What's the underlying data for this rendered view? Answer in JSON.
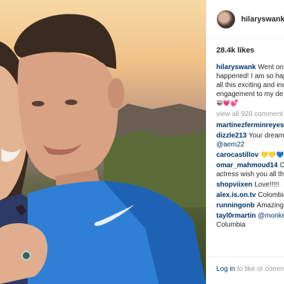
{
  "post": {
    "username": "hilaryswank",
    "likes": "28.4k likes",
    "caption": {
      "user": "hilaryswank",
      "lines": [
        "Went on",
        "happened! I am so hap",
        "all this exciting and inc",
        "engagement to my de"
      ],
      "emoji": "😀💗💕"
    },
    "view_all": "view all 928 comment",
    "comments": [
      {
        "user": "martinezferminreyes",
        "text": ""
      },
      {
        "user": "dizzle213",
        "text": "Your dream",
        "cont": "@aem22"
      },
      {
        "user": "carocastillov",
        "text": "💛💛💙❤"
      },
      {
        "user": "omar_mahmoud14",
        "text": "Co",
        "cont": "actress wish you all th"
      },
      {
        "user": "shopviixen",
        "text": "Love!!!!!"
      },
      {
        "user": "alex.is.on.tv",
        "text": "Colombia"
      },
      {
        "user": "runningonb",
        "text": "Amazing"
      },
      {
        "user": "tayl0rmartin",
        "text": "@monke",
        "cont": "Columbia"
      }
    ],
    "footer": {
      "login": "Log in",
      "rest": " to like or comm"
    }
  }
}
